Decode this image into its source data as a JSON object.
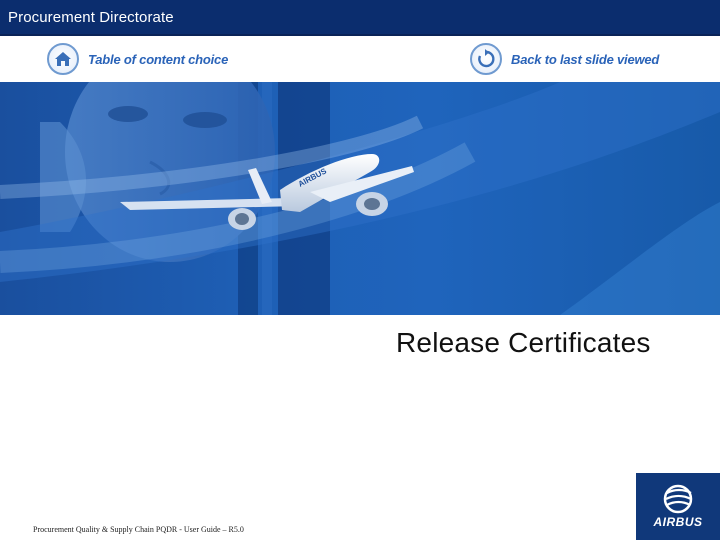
{
  "header": {
    "title": "Procurement Directorate"
  },
  "nav": {
    "toc_label": "Table of content choice",
    "back_label": "Back to last slide viewed"
  },
  "slide": {
    "title": "Release Certificates",
    "footer": "Procurement Quality & Supply Chain PQDR - User Guide – R5.0"
  },
  "logo": {
    "text": "AIRBUS",
    "aircraft_livery": "AIRBUS"
  },
  "colors": {
    "header_bg": "#0b2d6e",
    "nav_text": "#2a63b8",
    "hero_blue": "#1e5fb5",
    "logo_bg": "#10387a"
  },
  "icons": {
    "toc": "home-icon",
    "back": "back-arrow-icon"
  }
}
